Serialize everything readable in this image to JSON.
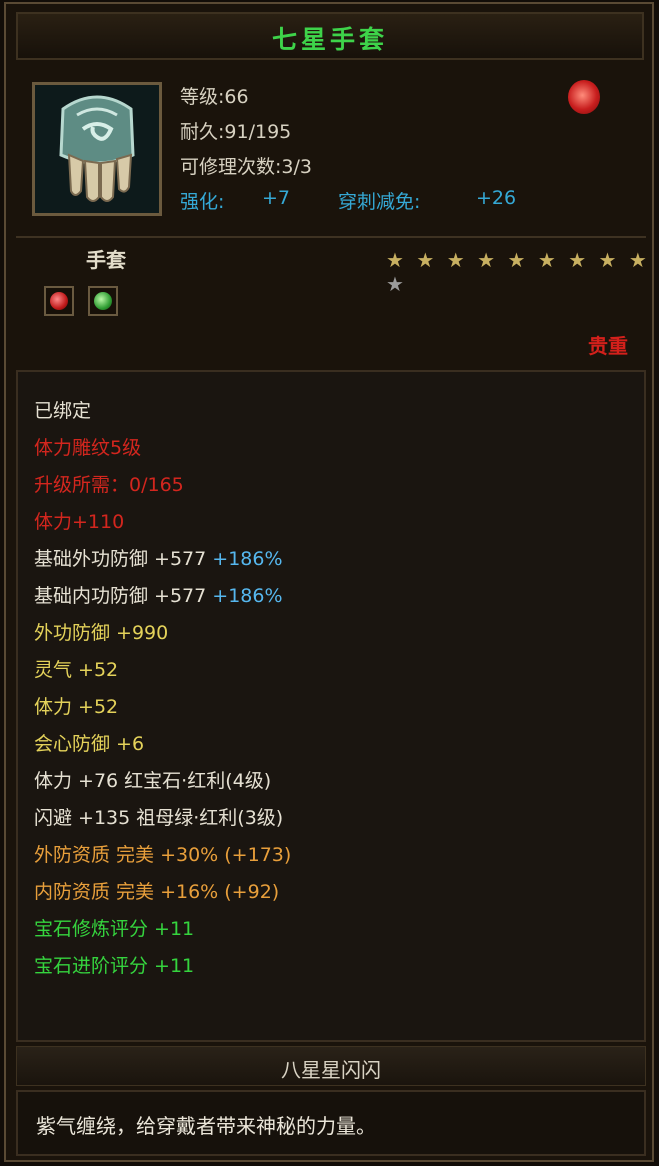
{
  "item": {
    "name": "七星手套",
    "level_label": "等级:66",
    "durability_label": "耐久:91/195",
    "repair_label": "可修理次数:3/3",
    "enhance_label": "强化:",
    "enhance_value": "+7",
    "pierce_label": "穿刺减免:",
    "pierce_value": "+26",
    "slot_type": "手套",
    "stars_total": 10,
    "stars_lit": 9,
    "rarity": "贵重"
  },
  "attributes": {
    "bound": "已绑定",
    "carve_level": "体力雕纹5级",
    "upgrade_req": "升级所需：0/165",
    "stamina_carve": "体力+110",
    "base_ext_def": "基础外功防御 +577",
    "base_ext_def_pct": "+186%",
    "base_int_def": "基础内功防御 +577",
    "base_int_def_pct": "+186%",
    "ext_def": "外功防御 +990",
    "spirit": "灵气 +52",
    "stamina": "体力 +52",
    "crit_def": "会心防御 +6",
    "gem1": "体力 +76 红宝石·红利(4级)",
    "gem2": "闪避 +135 祖母绿·红利(3级)",
    "ext_quality": "外防资质  完美 +30% (+173)",
    "int_quality": "内防资质  完美 +16% (+92)",
    "gem_refine_score": "宝石修炼评分 +11",
    "gem_advance_score": "宝石进阶评分 +11"
  },
  "nickname": "八星星闪闪",
  "description": "紫气缠绕，给穿戴者带来神秘的力量。",
  "colors": {
    "title_green": "#3ed34a",
    "stat_blue": "#35a9d6",
    "rare_red": "#d4201b",
    "attr_yellow": "#e4d25a",
    "quality_orange": "#e89f3b",
    "score_green": "#35d43e"
  }
}
